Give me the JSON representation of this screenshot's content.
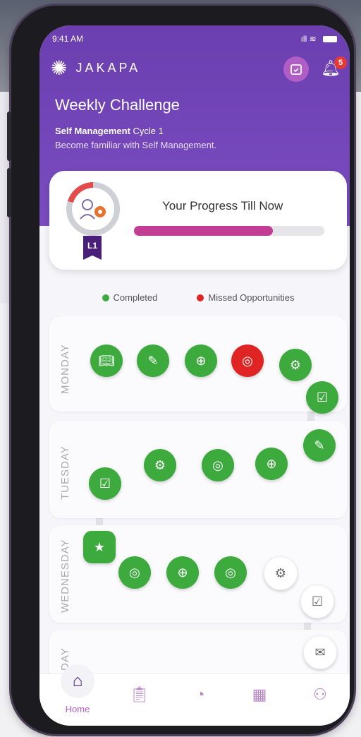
{
  "status": {
    "time": "9:41 AM",
    "signal": "ıll",
    "wifi": "≋"
  },
  "app": {
    "name": "JAKAPA",
    "notification_count": "5"
  },
  "challenge": {
    "title": "Weekly Challenge",
    "cycle_bold": "Self Management",
    "cycle_rest": " Cycle 1",
    "description": "Become familiar with Self Management."
  },
  "progress": {
    "label": "Your Progress Till Now",
    "level": "L1",
    "fraction": 0.73
  },
  "legend": {
    "completed": "Completed",
    "missed": "Missed Opportunities"
  },
  "days": {
    "monday": "MONDAY",
    "tuesday": "TUESDAY",
    "wednesday": "WEDNESDAY",
    "thursday_partial": "DAY"
  },
  "nav": {
    "home": "Home"
  },
  "colors": {
    "completed": "#3daa3e",
    "missed": "#e02424",
    "accent": "#b05ec6",
    "header": "#6b3fb0"
  }
}
